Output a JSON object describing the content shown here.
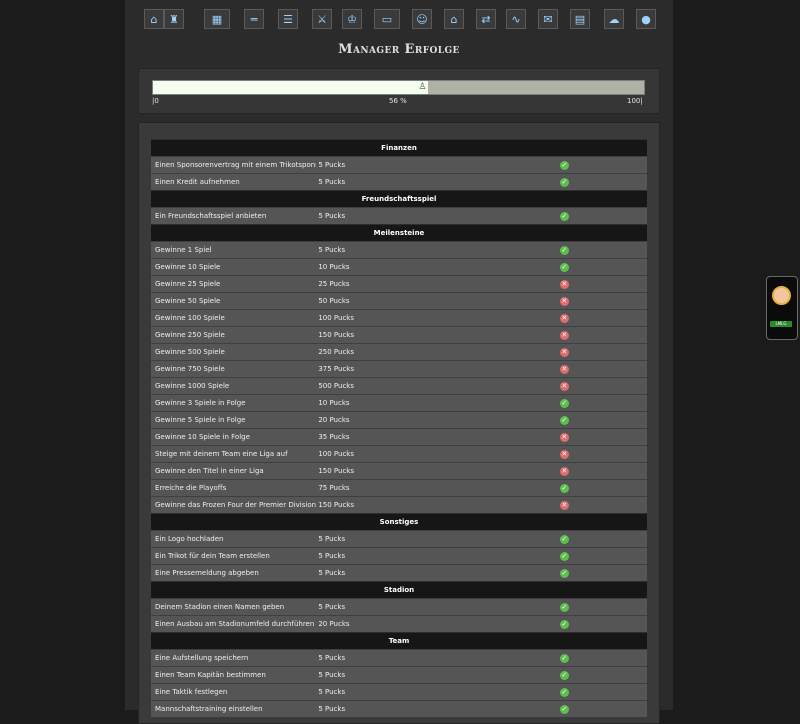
{
  "header": {
    "title": "Manager Erfolge",
    "nav": [
      {
        "icon": "home-icon",
        "glyph": "⌂"
      },
      {
        "icon": "jersey-icon",
        "glyph": "♜"
      },
      {
        "icon": "lineup-icon",
        "glyph": "▦"
      },
      {
        "icon": "training-icon",
        "glyph": "═"
      },
      {
        "icon": "list-icon",
        "glyph": "☰"
      },
      {
        "icon": "versus-icon",
        "glyph": "⚔"
      },
      {
        "icon": "trophy-icon",
        "glyph": "♔"
      },
      {
        "icon": "rink-icon",
        "glyph": "▭"
      },
      {
        "icon": "manager-icon",
        "glyph": "☺"
      },
      {
        "icon": "arena-icon",
        "glyph": "⌂"
      },
      {
        "icon": "transfer-icon",
        "glyph": "⇄"
      },
      {
        "icon": "stats-icon",
        "glyph": "∿"
      },
      {
        "icon": "mail-icon",
        "glyph": "✉"
      },
      {
        "icon": "news-icon",
        "glyph": "▤"
      },
      {
        "icon": "chat-icon",
        "glyph": "☁"
      },
      {
        "icon": "logout-icon",
        "glyph": "●"
      }
    ]
  },
  "progress": {
    "value_percent": 56,
    "label": "56 %",
    "min_label": "|0",
    "max_label": "100|"
  },
  "sections": [
    {
      "title": "Finanzen",
      "rows": [
        {
          "name": "Einen Sponsorenvertrag mit einem Trikotsponsor unterzeichnen",
          "reward": "5 Pucks",
          "done": true
        },
        {
          "name": "Einen Kredit aufnehmen",
          "reward": "5 Pucks",
          "done": true
        }
      ]
    },
    {
      "title": "Freundschaftsspiel",
      "rows": [
        {
          "name": "Ein Freundschaftsspiel anbieten",
          "reward": "5 Pucks",
          "done": true
        }
      ]
    },
    {
      "title": "Meilensteine",
      "rows": [
        {
          "name": "Gewinne 1 Spiel",
          "reward": "5 Pucks",
          "done": true
        },
        {
          "name": "Gewinne 10 Spiele",
          "reward": "10 Pucks",
          "done": true
        },
        {
          "name": "Gewinne 25 Spiele",
          "reward": "25 Pucks",
          "done": false
        },
        {
          "name": "Gewinne 50 Spiele",
          "reward": "50 Pucks",
          "done": false
        },
        {
          "name": "Gewinne 100 Spiele",
          "reward": "100 Pucks",
          "done": false
        },
        {
          "name": "Gewinne 250 Spiele",
          "reward": "150 Pucks",
          "done": false
        },
        {
          "name": "Gewinne 500 Spiele",
          "reward": "250 Pucks",
          "done": false
        },
        {
          "name": "Gewinne 750 Spiele",
          "reward": "375 Pucks",
          "done": false
        },
        {
          "name": "Gewinne 1000 Spiele",
          "reward": "500 Pucks",
          "done": false
        },
        {
          "name": "Gewinne 3 Spiele in Folge",
          "reward": "10 Pucks",
          "done": true
        },
        {
          "name": "Gewinne 5 Spiele in Folge",
          "reward": "20 Pucks",
          "done": true
        },
        {
          "name": "Gewinne 10 Spiele in Folge",
          "reward": "35 Pucks",
          "done": false
        },
        {
          "name": "Steige mit deinem Team eine Liga auf",
          "reward": "100 Pucks",
          "done": false
        },
        {
          "name": "Gewinne den Titel in einer Liga",
          "reward": "150 Pucks",
          "done": false
        },
        {
          "name": "Erreiche die Playoffs",
          "reward": "75 Pucks",
          "done": true
        },
        {
          "name": "Gewinne das Frozen Four der Premier Division",
          "reward": "150 Pucks",
          "done": false
        }
      ]
    },
    {
      "title": "Sonstiges",
      "rows": [
        {
          "name": "Ein Logo hochladen",
          "reward": "5 Pucks",
          "done": true
        },
        {
          "name": "Ein Trikot für dein Team erstellen",
          "reward": "5 Pucks",
          "done": true
        },
        {
          "name": "Eine Pressemeldung abgeben",
          "reward": "5 Pucks",
          "done": true
        }
      ]
    },
    {
      "title": "Stadion",
      "rows": [
        {
          "name": "Deinem Stadion einen Namen geben",
          "reward": "5 Pucks",
          "done": true
        },
        {
          "name": "Einen Ausbau am Stadionumfeld durchführen",
          "reward": "20 Pucks",
          "done": true
        }
      ]
    },
    {
      "title": "Team",
      "rows": [
        {
          "name": "Eine Aufstellung speichern",
          "reward": "5 Pucks",
          "done": true
        },
        {
          "name": "Einen Team Kapitän bestimmen",
          "reward": "5 Pucks",
          "done": true
        },
        {
          "name": "Eine Taktik festlegen",
          "reward": "5 Pucks",
          "done": true
        },
        {
          "name": "Mannschaftstraining einstellen",
          "reward": "5 Pucks",
          "done": true
        }
      ]
    }
  ],
  "side_widget": {
    "icon": "assistant-avatar-icon",
    "label": "LMLG"
  },
  "colors": {
    "done": "#5fbf4e",
    "not_done": "#df6b6b",
    "progress_fill": "#f4fff0",
    "progress_track": "#aeb2a6"
  }
}
